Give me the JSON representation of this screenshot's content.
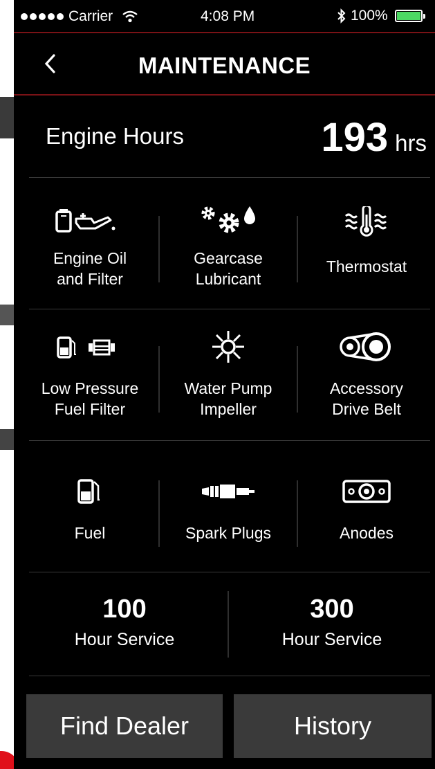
{
  "status_bar": {
    "carrier": "Carrier",
    "time": "4:08 PM",
    "battery": "100%"
  },
  "nav": {
    "title": "MAINTENANCE"
  },
  "engine_hours": {
    "label": "Engine Hours",
    "value": "193",
    "unit": "hrs"
  },
  "items": [
    {
      "label_line1": "Engine Oil",
      "label_line2": "and Filter",
      "icon": "oil-can-icon"
    },
    {
      "label_line1": "Gearcase",
      "label_line2": "Lubricant",
      "icon": "gears-drop-icon"
    },
    {
      "label_line1": "Thermostat",
      "label_line2": "",
      "icon": "thermometer-waves-icon"
    },
    {
      "label_line1": "Low Pressure",
      "label_line2": "Fuel Filter",
      "icon": "fuel-filter-icon"
    },
    {
      "label_line1": "Water Pump",
      "label_line2": "Impeller",
      "icon": "impeller-icon"
    },
    {
      "label_line1": "Accessory",
      "label_line2": "Drive Belt",
      "icon": "drive-belt-icon"
    },
    {
      "label_line1": "Fuel",
      "label_line2": "",
      "icon": "fuel-pump-icon"
    },
    {
      "label_line1": "Spark Plugs",
      "label_line2": "",
      "icon": "spark-plug-icon"
    },
    {
      "label_line1": "Anodes",
      "label_line2": "",
      "icon": "anode-icon"
    }
  ],
  "services": [
    {
      "number": "100",
      "label": "Hour Service"
    },
    {
      "number": "300",
      "label": "Hour Service"
    }
  ],
  "buttons": {
    "find_dealer": "Find Dealer",
    "history": "History"
  },
  "colors": {
    "background": "#000000",
    "accent": "#7a1216",
    "button": "#3a3a3a",
    "battery": "#4cd964"
  }
}
